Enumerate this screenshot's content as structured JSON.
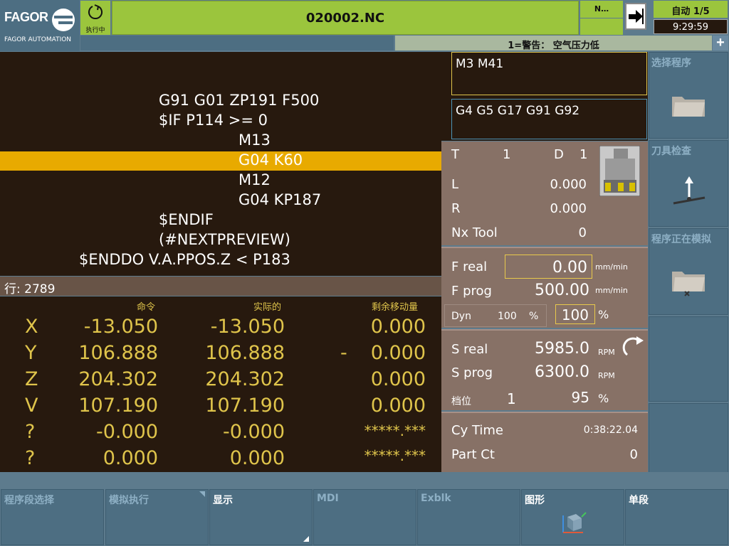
{
  "header": {
    "brand": "FAGOR",
    "brand_sub": "FAGOR AUTOMATION",
    "status_label": "执行中",
    "program_title": "020002.NC",
    "n_box": "N…",
    "mode": "自动 1/5",
    "time": "9:29:59",
    "alarm": "1=警告： 空气压力低"
  },
  "program": {
    "lines": [
      {
        "text": "G91 G01 ZP191 F500",
        "indent": 1
      },
      {
        "text": "$IF P114 >= 0",
        "indent": 1
      },
      {
        "text": "M13",
        "indent": 2
      },
      {
        "text": "G04 K60",
        "indent": 2,
        "highlight": true
      },
      {
        "text": "M12",
        "indent": 2
      },
      {
        "text": "G04 KP187",
        "indent": 2
      },
      {
        "text": "$ENDIF",
        "indent": 1
      },
      {
        "text": "(#NEXTPREVIEW)",
        "indent": 1
      },
      {
        "text": "$ENDDO V.A.PPOS.Z < P183",
        "indent": 0
      }
    ],
    "line_number": "行: 2789"
  },
  "axes": {
    "headers": [
      "命令",
      "实际的",
      "剩余移动量"
    ],
    "rows": [
      {
        "name": "X",
        "command": "-13.050",
        "actual": "-13.050",
        "sign": "",
        "remaining": "0.000"
      },
      {
        "name": "Y",
        "command": "106.888",
        "actual": "106.888",
        "sign": "-",
        "remaining": "0.000"
      },
      {
        "name": "Z",
        "command": "204.302",
        "actual": "204.302",
        "sign": "",
        "remaining": "0.000"
      },
      {
        "name": "V",
        "command": "107.190",
        "actual": "107.190",
        "sign": "",
        "remaining": "0.000"
      },
      {
        "name": "?",
        "command": "-0.000",
        "actual": "-0.000",
        "sign": "",
        "remaining": "*****.***"
      },
      {
        "name": "?",
        "command": "0.000",
        "actual": "0.000",
        "sign": "",
        "remaining": "*****.***"
      }
    ]
  },
  "mcodes": "M3 M41",
  "gcodes": "G4 G5 G17 G91 G92",
  "tool": {
    "t_label": "T",
    "t_value": "1",
    "d_label": "D",
    "d_value": "1",
    "l_label": "L",
    "l_value": "0.000",
    "r_label": "R",
    "r_value": "0.000",
    "nx_label": "Nx Tool",
    "nx_value": "0"
  },
  "feed": {
    "freal_label": "F real",
    "freal_value": "0.00",
    "freal_unit": "mm/min",
    "fprog_label": "F prog",
    "fprog_value": "500.00",
    "fprog_unit": "mm/min",
    "dyn_label": "Dyn",
    "dyn_value": "100",
    "dyn_unit": "%",
    "override_value": "100",
    "override_unit": "%"
  },
  "spindle": {
    "sreal_label": "S real",
    "sreal_value": "5985.0",
    "sreal_unit": "RPM",
    "sprog_label": "S prog",
    "sprog_value": "6300.0",
    "sprog_unit": "RPM",
    "gear_label": "档位",
    "gear_value": "1",
    "ovr_value": "95",
    "ovr_unit": "%"
  },
  "cycle": {
    "cytime_label": "Cy Time",
    "cytime_value": "0:38:22.04",
    "partct_label": "Part Ct",
    "partct_value": "0"
  },
  "side_buttons": [
    "选择程序",
    "刀具检查",
    "程序正在模拟",
    "",
    ""
  ],
  "soft_keys": [
    "程序段选择",
    "模拟执行",
    "显示",
    "MDI",
    "Exblk",
    "图形",
    "单段"
  ],
  "colors": {
    "accent_green": "#9bc53d",
    "highlight": "#e8aa00",
    "axis_text": "#dfc44b",
    "panel": "#877166"
  }
}
